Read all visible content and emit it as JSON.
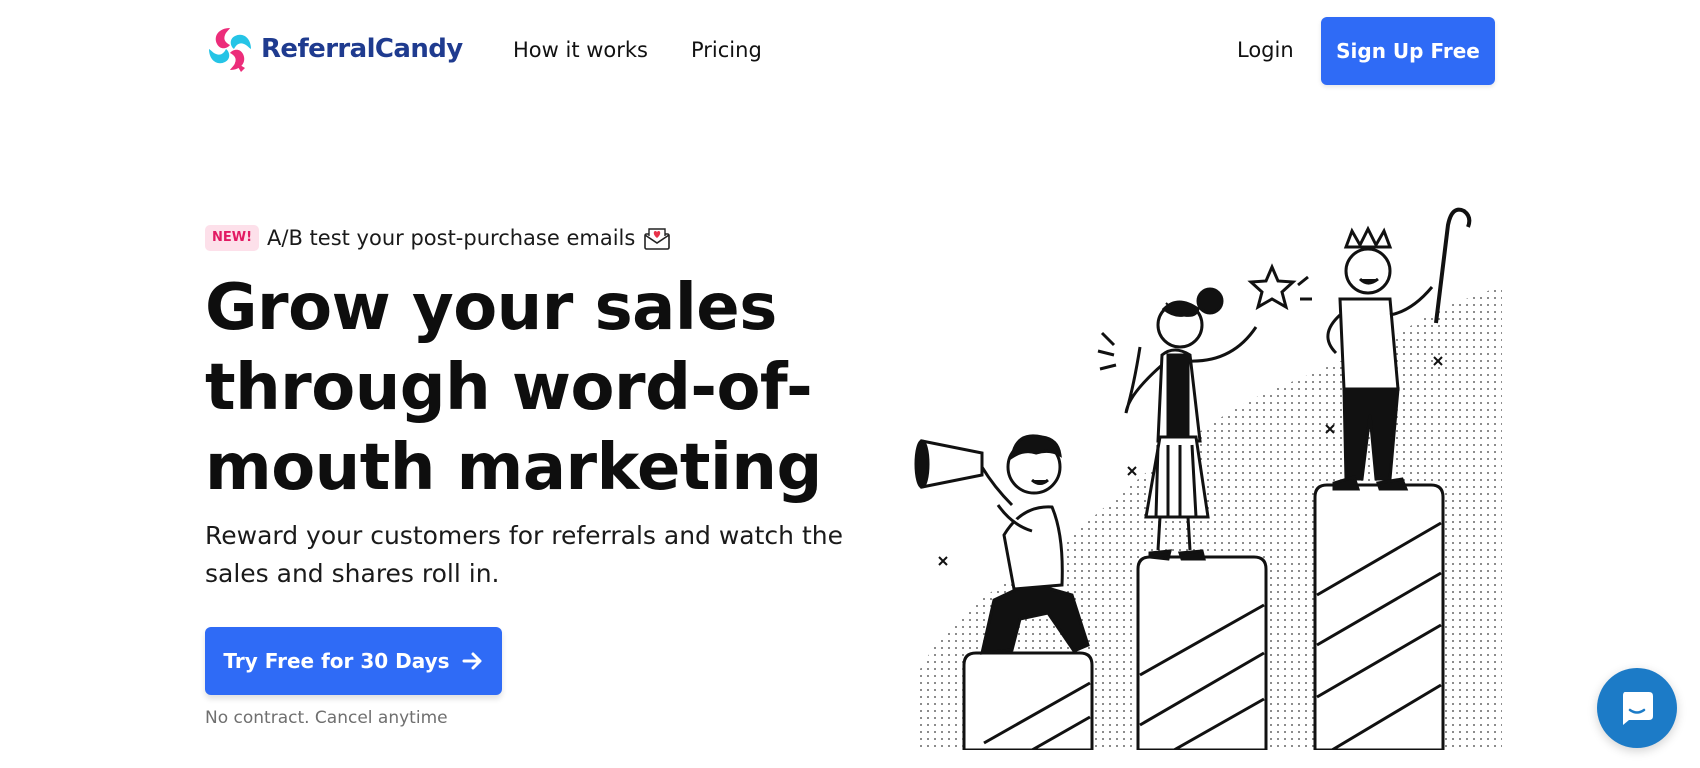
{
  "brand": {
    "name": "ReferralCandy",
    "colors": {
      "primary": "#2f6bf6",
      "logo_text": "#1f3b8f",
      "logo_pink": "#ec2d7a",
      "logo_cyan": "#25c4e6",
      "new_badge_text": "#e21a63",
      "new_badge_bg": "#fde0ea",
      "chat": "#1c7bc7"
    }
  },
  "header": {
    "nav": [
      {
        "label": "How it works"
      },
      {
        "label": "Pricing"
      }
    ],
    "login_label": "Login",
    "signup_label": "Sign Up Free"
  },
  "announcement": {
    "badge": "NEW!",
    "text": "A/B test your post-purchase emails",
    "icon": "envelope-heart-icon"
  },
  "hero": {
    "title": "Grow your sales through word-of-mouth marketing",
    "subtitle": "Reward your customers for referrals and watch the sales and shares roll in.",
    "cta_label": "Try Free for 30 Days",
    "cta_icon": "arrow-right-icon",
    "cta_note": "No contract. Cancel anytime"
  },
  "illustration": {
    "subject": "three people celebrating on rising podium bars",
    "icons": [
      "megaphone-icon",
      "star-icon",
      "crown-icon",
      "candy-cane-icon"
    ]
  },
  "chat": {
    "icon": "chat-bubble-icon"
  }
}
